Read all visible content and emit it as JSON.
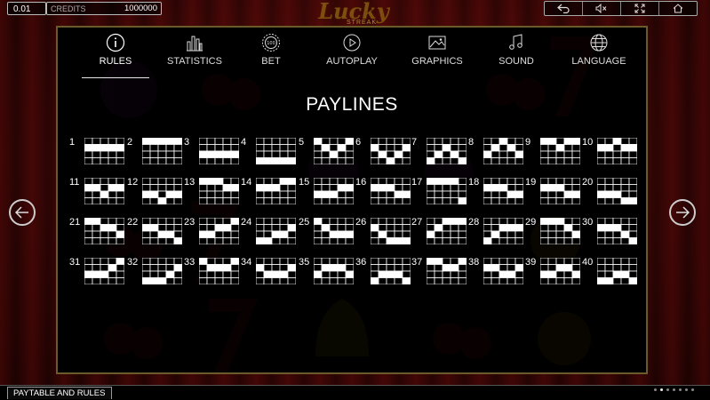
{
  "header": {
    "bet_value": "0.01",
    "credits_label": "CREDITS",
    "credits_value": "1000000",
    "logo_text": "Lucky",
    "logo_sub": "STREAK",
    "controls": [
      {
        "name": "back-icon"
      },
      {
        "name": "mute-icon"
      },
      {
        "name": "fullscreen-icon"
      },
      {
        "name": "home-icon"
      }
    ]
  },
  "tabs": [
    {
      "label": "RULES",
      "icon": "info-icon",
      "active": true
    },
    {
      "label": "STATISTICS",
      "icon": "statistics-icon",
      "active": false
    },
    {
      "label": "BET",
      "icon": "bet-chip-icon",
      "active": false
    },
    {
      "label": "AUTOPLAY",
      "icon": "autoplay-icon",
      "active": false
    },
    {
      "label": "GRAPHICS",
      "icon": "graphics-icon",
      "active": false
    },
    {
      "label": "SOUND",
      "icon": "sound-icon",
      "active": false
    },
    {
      "label": "LANGUAGE",
      "icon": "globe-icon",
      "active": false
    }
  ],
  "page_title": "PAYLINES",
  "paylines": [
    {
      "n": "1",
      "rows": [
        1,
        1,
        1,
        1,
        1
      ]
    },
    {
      "n": "2",
      "rows": [
        0,
        0,
        0,
        0,
        0
      ]
    },
    {
      "n": "3",
      "rows": [
        2,
        2,
        2,
        2,
        2
      ]
    },
    {
      "n": "4",
      "rows": [
        3,
        3,
        3,
        3,
        3
      ]
    },
    {
      "n": "5",
      "rows": [
        0,
        1,
        2,
        1,
        0
      ]
    },
    {
      "n": "6",
      "rows": [
        1,
        2,
        3,
        2,
        1
      ]
    },
    {
      "n": "7",
      "rows": [
        3,
        2,
        1,
        2,
        3
      ]
    },
    {
      "n": "8",
      "rows": [
        2,
        1,
        0,
        1,
        2
      ]
    },
    {
      "n": "9",
      "rows": [
        0,
        0,
        1,
        0,
        0
      ]
    },
    {
      "n": "10",
      "rows": [
        1,
        1,
        0,
        1,
        1
      ]
    },
    {
      "n": "11",
      "rows": [
        1,
        1,
        2,
        1,
        1
      ]
    },
    {
      "n": "12",
      "rows": [
        2,
        2,
        3,
        2,
        2
      ]
    },
    {
      "n": "13",
      "rows": [
        0,
        0,
        0,
        1,
        1
      ]
    },
    {
      "n": "14",
      "rows": [
        1,
        1,
        1,
        0,
        0
      ]
    },
    {
      "n": "15",
      "rows": [
        2,
        2,
        2,
        1,
        1
      ]
    },
    {
      "n": "16",
      "rows": [
        1,
        1,
        1,
        2,
        2
      ]
    },
    {
      "n": "17",
      "rows": [
        0,
        0,
        0,
        0,
        3
      ]
    },
    {
      "n": "18",
      "rows": [
        1,
        1,
        1,
        2,
        2
      ]
    },
    {
      "n": "19",
      "rows": [
        1,
        1,
        1,
        2,
        2
      ]
    },
    {
      "n": "20",
      "rows": [
        2,
        2,
        2,
        3,
        3
      ]
    },
    {
      "n": "21",
      "rows": [
        0,
        0,
        1,
        1,
        2
      ]
    },
    {
      "n": "22",
      "rows": [
        1,
        1,
        2,
        2,
        3
      ]
    },
    {
      "n": "23",
      "rows": [
        2,
        2,
        1,
        1,
        0
      ]
    },
    {
      "n": "24",
      "rows": [
        3,
        3,
        2,
        2,
        1
      ]
    },
    {
      "n": "25",
      "rows": [
        0,
        1,
        2,
        2,
        2
      ]
    },
    {
      "n": "26",
      "rows": [
        1,
        2,
        3,
        3,
        3
      ]
    },
    {
      "n": "27",
      "rows": [
        2,
        1,
        0,
        0,
        0
      ]
    },
    {
      "n": "28",
      "rows": [
        3,
        2,
        1,
        1,
        1
      ]
    },
    {
      "n": "29",
      "rows": [
        0,
        0,
        0,
        1,
        2
      ]
    },
    {
      "n": "30",
      "rows": [
        1,
        1,
        1,
        2,
        3
      ]
    },
    {
      "n": "31",
      "rows": [
        2,
        2,
        2,
        1,
        0
      ]
    },
    {
      "n": "32",
      "rows": [
        3,
        3,
        3,
        2,
        1
      ]
    },
    {
      "n": "33",
      "rows": [
        0,
        1,
        1,
        1,
        0
      ]
    },
    {
      "n": "34",
      "rows": [
        1,
        2,
        2,
        2,
        1
      ]
    },
    {
      "n": "35",
      "rows": [
        2,
        1,
        1,
        1,
        2
      ]
    },
    {
      "n": "36",
      "rows": [
        3,
        2,
        2,
        2,
        3
      ]
    },
    {
      "n": "37",
      "rows": [
        0,
        0,
        1,
        1,
        0
      ]
    },
    {
      "n": "38",
      "rows": [
        1,
        1,
        2,
        2,
        1
      ]
    },
    {
      "n": "39",
      "rows": [
        2,
        2,
        1,
        1,
        2
      ]
    },
    {
      "n": "40",
      "rows": [
        3,
        3,
        2,
        2,
        3
      ]
    }
  ],
  "footer": {
    "label": "PAYTABLE AND RULES",
    "page_dots": 7,
    "active_dot": 1
  },
  "colors": {
    "accent_gold": "#6b5a2a",
    "background_red": "#5a0d0b",
    "cell_white": "#ffffff"
  }
}
